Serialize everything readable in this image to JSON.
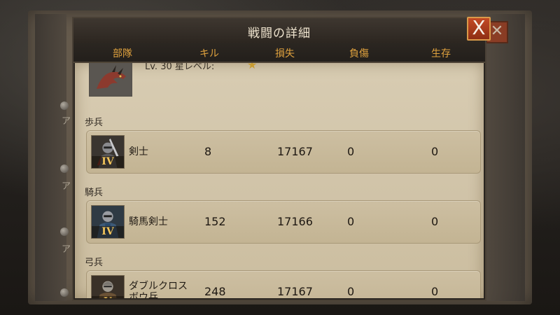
{
  "dialog": {
    "title": "戦闘の詳細",
    "close_label": "X"
  },
  "headers": [
    "部隊",
    "キル",
    "損失",
    "負傷",
    "生存"
  ],
  "partial_row": {
    "text": "Lv. 30 星レベル:",
    "star_icon": "star-icon"
  },
  "sections": [
    {
      "label": "歩兵",
      "unit": {
        "name": "剣士",
        "tier": "IV",
        "kills": "8",
        "losses": "17167",
        "wounded": "0",
        "survived": "0",
        "icon": "swordsman-portrait"
      }
    },
    {
      "label": "騎兵",
      "unit": {
        "name": "騎馬剣士",
        "tier": "IV",
        "kills": "152",
        "losses": "17166",
        "wounded": "0",
        "survived": "0",
        "icon": "mounted-swordsman-portrait"
      }
    },
    {
      "label": "弓兵",
      "unit": {
        "name": "ダブルクロスボウ兵",
        "tier": "V",
        "kills": "248",
        "losses": "17167",
        "wounded": "0",
        "survived": "0",
        "icon": "double-crossbowman-portrait"
      }
    }
  ],
  "background": {
    "side_text": [
      "ア",
      "ア",
      "ア"
    ]
  },
  "colors": {
    "header_text": "#e0a23e",
    "close_button": "#c34a24",
    "tier_numeral": "#f3c55a",
    "content_bg": "#d8ccb2"
  }
}
